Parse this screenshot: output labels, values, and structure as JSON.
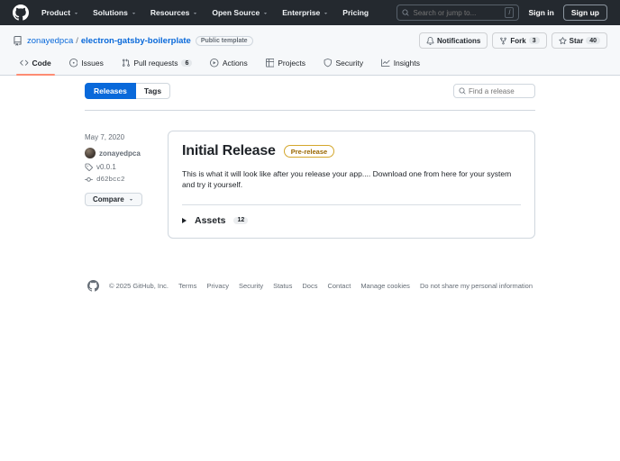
{
  "header": {
    "nav": [
      {
        "label": "Product",
        "chevron": true
      },
      {
        "label": "Solutions",
        "chevron": true
      },
      {
        "label": "Resources",
        "chevron": true
      },
      {
        "label": "Open Source",
        "chevron": true
      },
      {
        "label": "Enterprise",
        "chevron": true
      },
      {
        "label": "Pricing",
        "chevron": false
      }
    ],
    "search": {
      "placeholder": "Search or jump to...",
      "shortcut_key": "/"
    },
    "sign_in_label": "Sign in",
    "sign_up_label": "Sign up"
  },
  "repo": {
    "owner": "zonayedpca",
    "separator": "/",
    "name": "electron-gatsby-boilerplate",
    "visibility_badge": "Public template",
    "actions": {
      "notifications_label": "Notifications",
      "fork": {
        "label": "Fork",
        "count": "3"
      },
      "star": {
        "label": "Star",
        "count": "40"
      }
    }
  },
  "tabs": [
    {
      "label": "Code"
    },
    {
      "label": "Issues"
    },
    {
      "label": "Pull requests",
      "count": "6"
    },
    {
      "label": "Actions"
    },
    {
      "label": "Projects"
    },
    {
      "label": "Security"
    },
    {
      "label": "Insights"
    }
  ],
  "release_nav": {
    "releases_label": "Releases",
    "tags_label": "Tags",
    "find_placeholder": "Find a release"
  },
  "release": {
    "date": "May 7, 2020",
    "author": "zonayedpca",
    "tag": "v0.0.1",
    "commit": "d62bcc2",
    "compare_label": "Compare",
    "title": "Initial Release",
    "badge": "Pre-release",
    "description": "This is what it will look like after you release your app.... Download one from here for your system and try it yourself.",
    "assets_label": "Assets",
    "assets_count": "12"
  },
  "footer": {
    "copyright": "© 2025 GitHub, Inc.",
    "links": [
      "Terms",
      "Privacy",
      "Security",
      "Status",
      "Docs",
      "Contact",
      "Manage cookies",
      "Do not share my personal information"
    ]
  },
  "colors": {
    "accent": "#0969da",
    "header_bg": "#24292f",
    "attention_fg": "#9a6700",
    "attention_border": "#d4a72c",
    "tab_underline": "#fd8c73",
    "surface_subtle": "#f6f8fa",
    "border": "#d0d7de",
    "fg": "#1f2328",
    "fg_muted": "#656d76"
  }
}
